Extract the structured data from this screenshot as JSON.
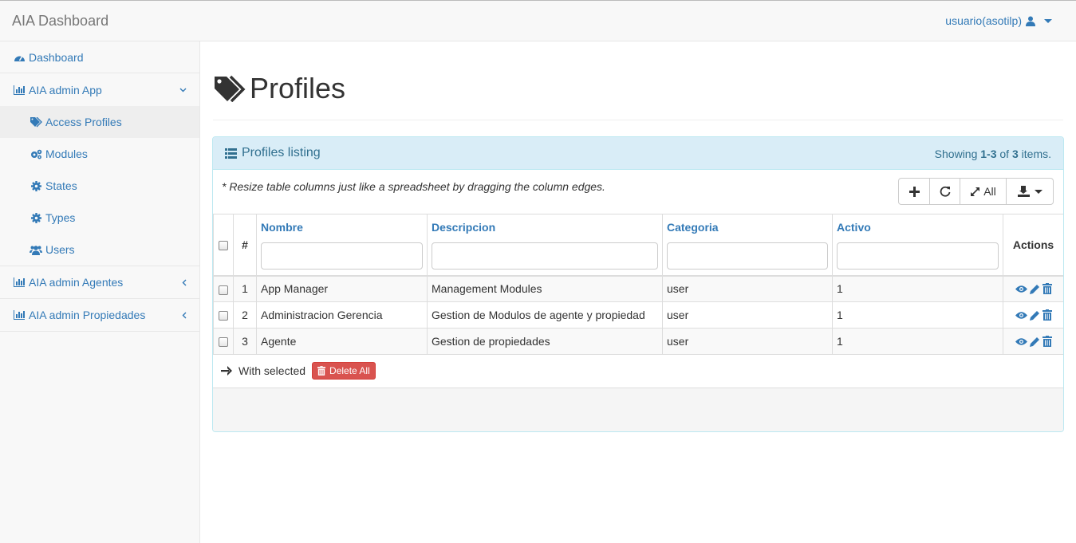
{
  "navbar": {
    "brand": "AIA Dashboard",
    "user": "usuario(asotilp)"
  },
  "sidebar": {
    "dashboard": "Dashboard",
    "group1": {
      "label": "AIA admin App",
      "items": [
        "Access Profiles",
        "Modules",
        "States",
        "Types",
        "Users"
      ]
    },
    "group2": "AIA admin Agentes",
    "group3": "AIA admin Propiedades"
  },
  "page": {
    "title": "Profiles"
  },
  "panel": {
    "title": "Profiles listing",
    "summary_prefix": "Showing ",
    "summary_range": "1-3",
    "summary_of": " of ",
    "summary_total": "3",
    "summary_suffix": " items.",
    "resize_note": "* Resize table columns just like a spreadsheet by dragging the column edges.",
    "toggle_all": "All"
  },
  "table": {
    "columns": {
      "num": "#",
      "nombre": "Nombre",
      "descripcion": "Descripcion",
      "categoria": "Categoria",
      "activo": "Activo",
      "actions": "Actions"
    },
    "rows": [
      {
        "num": "1",
        "nombre": "App Manager",
        "descripcion": "Management Modules",
        "categoria": "user",
        "activo": "1"
      },
      {
        "num": "2",
        "nombre": "Administracion Gerencia",
        "descripcion": "Gestion de Modulos de agente y propiedad",
        "categoria": "user",
        "activo": "1"
      },
      {
        "num": "3",
        "nombre": "Agente",
        "descripcion": "Gestion de propiedades",
        "categoria": "user",
        "activo": "1"
      }
    ]
  },
  "bulk": {
    "with_selected": "With selected",
    "delete_all": "Delete All"
  },
  "colors": {
    "link": "#337ab7",
    "panel_heading": "#d9edf7",
    "danger": "#d9534f"
  }
}
